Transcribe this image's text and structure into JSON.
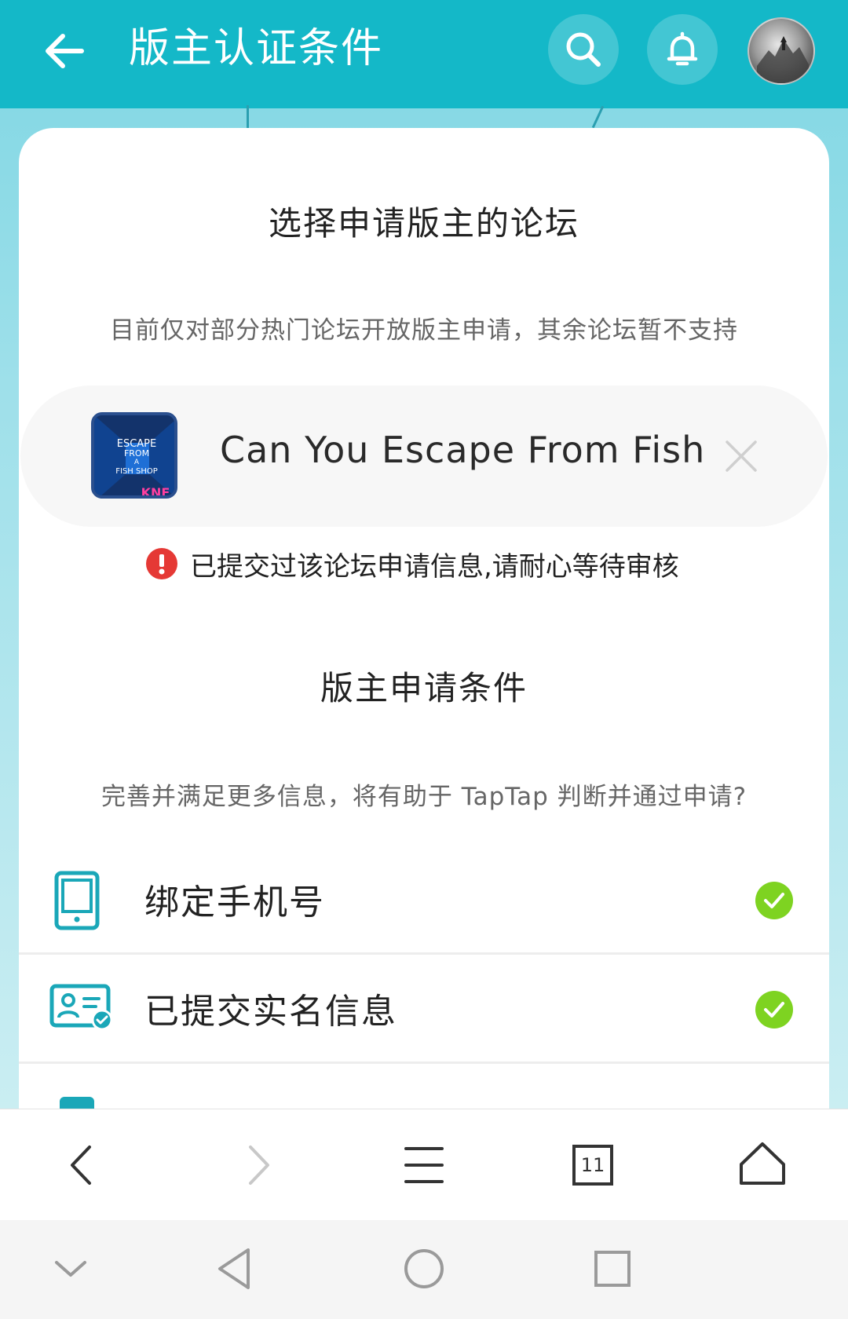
{
  "header": {
    "title": "版主认证条件"
  },
  "forum_section": {
    "title": "选择申请版主的论坛",
    "subtitle": "目前仅对部分热门论坛开放版主申请，其余论坛暂不支持",
    "selected_forum": {
      "name": "Can You Escape From Fish",
      "icon_lines": [
        "ESCAPE",
        "FROM",
        "A",
        "FISH SHOP"
      ],
      "icon_badge": "KNF"
    },
    "notice": "已提交过该论坛申请信息,请耐心等待审核"
  },
  "requirements_section": {
    "title": "版主申请条件",
    "subtitle": "完善并满足更多信息，将有助于 TapTap 判断并通过申请?",
    "items": [
      {
        "label": "绑定手机号",
        "icon": "phone-icon",
        "done": true
      },
      {
        "label": "已提交实名信息",
        "icon": "id-card-icon",
        "done": true
      }
    ]
  },
  "browser_nav": {
    "tab_count": "11"
  },
  "colors": {
    "header": "#14b8c8",
    "accent": "#1aa7b8",
    "check": "#7ed321",
    "error": "#e53935"
  }
}
